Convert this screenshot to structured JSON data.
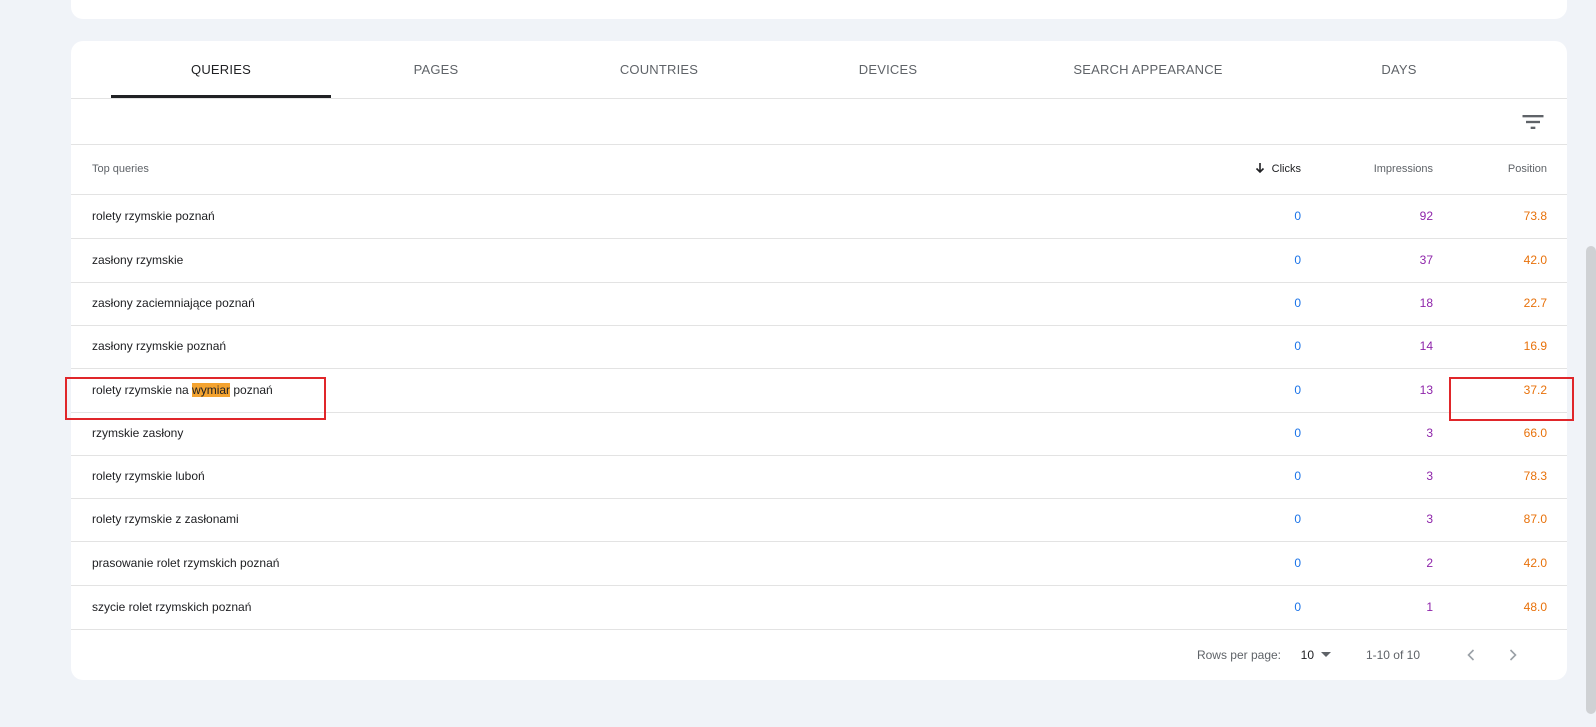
{
  "tabs": [
    {
      "label": "QUERIES",
      "active": true
    },
    {
      "label": "PAGES",
      "active": false
    },
    {
      "label": "COUNTRIES",
      "active": false
    },
    {
      "label": "DEVICES",
      "active": false
    },
    {
      "label": "SEARCH APPEARANCE",
      "active": false
    },
    {
      "label": "DAYS",
      "active": false
    }
  ],
  "filter_icon": "filter-list-icon",
  "table": {
    "headers": {
      "query": "Top queries",
      "clicks": "Clicks",
      "impressions": "Impressions",
      "position": "Position"
    },
    "sort_icon": "arrow-down-icon",
    "rows": [
      {
        "query": "rolety rzymskie poznań",
        "clicks": "0",
        "impressions": "92",
        "position": "73.8"
      },
      {
        "query": "zasłony rzymskie",
        "clicks": "0",
        "impressions": "37",
        "position": "42.0"
      },
      {
        "query": "zasłony zaciemniające poznań",
        "clicks": "0",
        "impressions": "18",
        "position": "22.7"
      },
      {
        "query": "zasłony rzymskie poznań",
        "clicks": "0",
        "impressions": "14",
        "position": "16.9"
      },
      {
        "query": "rolety rzymskie na wymiar poznań",
        "query_before": "rolety rzymskie na ",
        "query_highlight": "wymiar",
        "query_after": " poznań",
        "clicks": "0",
        "impressions": "13",
        "position": "37.2"
      },
      {
        "query": "rzymskie zasłony",
        "clicks": "0",
        "impressions": "3",
        "position": "66.0"
      },
      {
        "query": "rolety rzymskie luboń",
        "clicks": "0",
        "impressions": "3",
        "position": "78.3"
      },
      {
        "query": "rolety rzymskie z zasłonami",
        "clicks": "0",
        "impressions": "3",
        "position": "87.0"
      },
      {
        "query": "prasowanie rolet rzymskich poznań",
        "clicks": "0",
        "impressions": "2",
        "position": "42.0"
      },
      {
        "query": "szycie rolet rzymskich poznań",
        "clicks": "0",
        "impressions": "1",
        "position": "48.0"
      }
    ]
  },
  "pagination": {
    "rows_per_page_label": "Rows per page:",
    "rows_per_page_value": "10",
    "range": "1-10 of 10",
    "prev_icon": "chevron-left-icon",
    "next_icon": "chevron-right-icon"
  },
  "colors": {
    "clicks": "#1a73e8",
    "impressions": "#8e24aa",
    "position": "#e8710a",
    "highlight": "#f4a32f",
    "annotation": "#e0262a"
  }
}
